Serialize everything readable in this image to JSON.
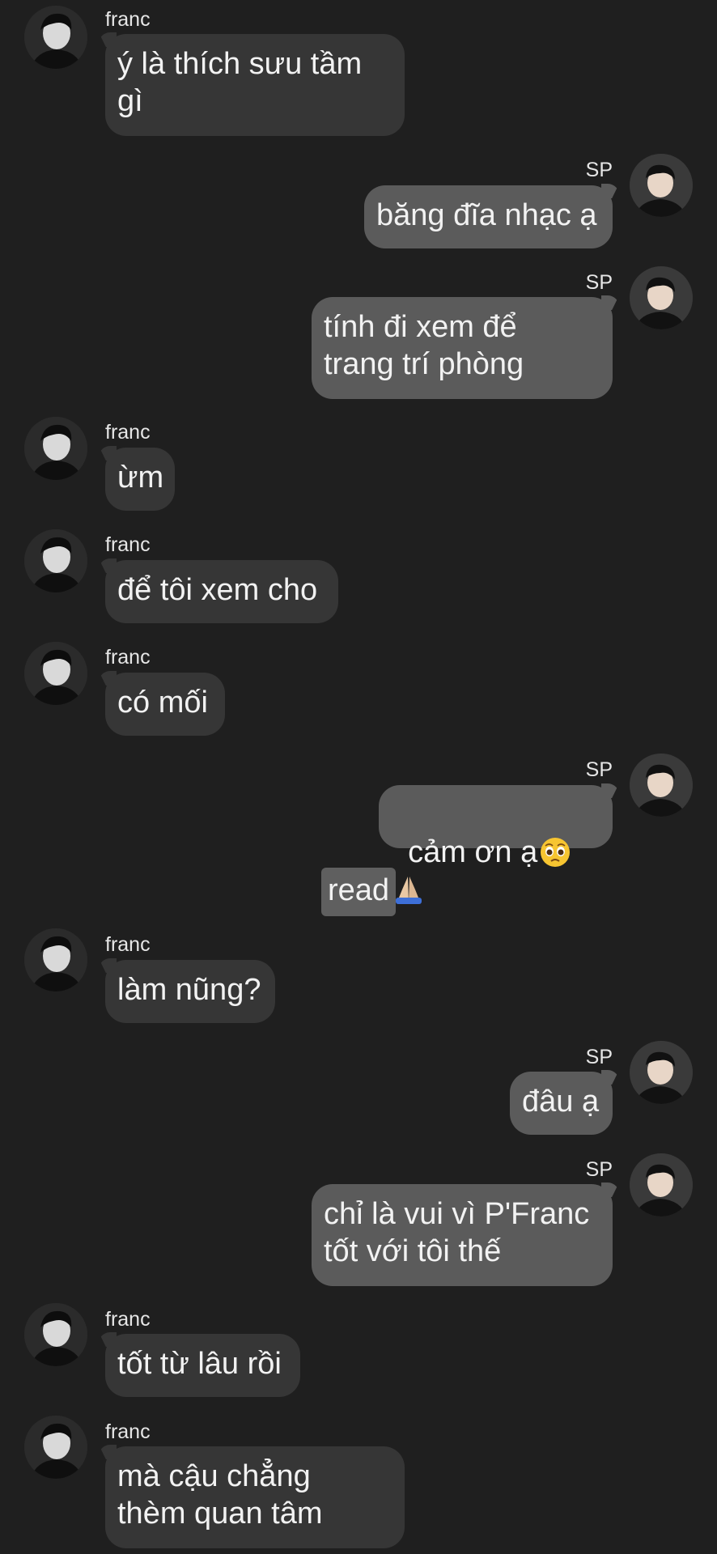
{
  "participants": {
    "franc": {
      "name": "franc"
    },
    "sp": {
      "name": "SP"
    }
  },
  "messages": [
    {
      "from": "franc",
      "text": "ý là thích sưu tầm\ngì"
    },
    {
      "from": "sp",
      "text": "băng đĩa nhạc ạ"
    },
    {
      "from": "sp",
      "text": "tính đi xem để\ntrang trí phòng"
    },
    {
      "from": "franc",
      "text": "ừm"
    },
    {
      "from": "franc",
      "text": "để tôi xem cho"
    },
    {
      "from": "franc",
      "text": "có mối"
    },
    {
      "from": "sp",
      "text": "cảm ơn ạ",
      "emojis": [
        "pleading-face",
        "folded-hands"
      ]
    },
    {
      "from": "franc",
      "text": "làm nũng?"
    },
    {
      "from": "sp",
      "text": "đâu ạ"
    },
    {
      "from": "sp",
      "text": "chỉ là vui vì P'Franc\ntốt với tôi thế"
    },
    {
      "from": "franc",
      "text": "tốt từ lâu rồi"
    },
    {
      "from": "franc",
      "text": "mà cậu chẳng\nthèm quan tâm"
    }
  ],
  "read_marker": {
    "label": "read"
  },
  "colors": {
    "background": "#1f1f1f",
    "incoming_bubble": "#363636",
    "outgoing_bubble": "#5b5b5b",
    "read_badge": "#5f5f5f",
    "text": "#f2f2f2"
  }
}
